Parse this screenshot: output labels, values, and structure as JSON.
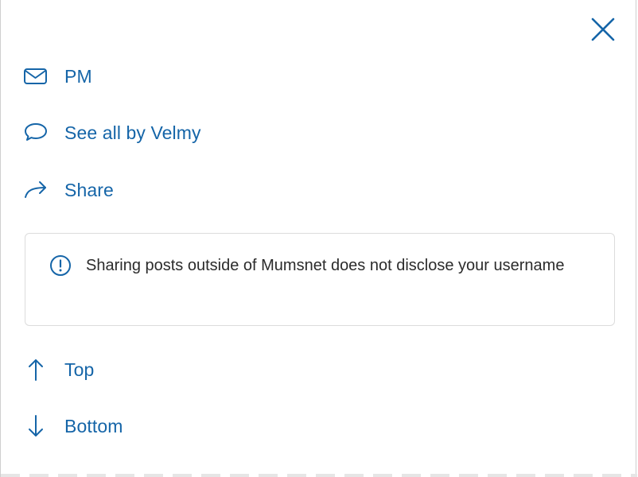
{
  "menu": {
    "pm_label": "PM",
    "see_all_label": "See all by Velmy",
    "share_label": "Share",
    "top_label": "Top",
    "bottom_label": "Bottom"
  },
  "notice": {
    "text": "Sharing posts outside of Mumsnet does not disclose your username"
  },
  "icons": {
    "close": "close-icon",
    "pm": "envelope-icon",
    "see_all": "speech-bubble-icon",
    "share": "share-arrow-icon",
    "info": "info-circle-icon",
    "top": "arrow-up-icon",
    "bottom": "arrow-down-icon"
  },
  "colors": {
    "accent": "#1565a8",
    "text": "#2b2b2b",
    "border": "#dcdcdc"
  }
}
